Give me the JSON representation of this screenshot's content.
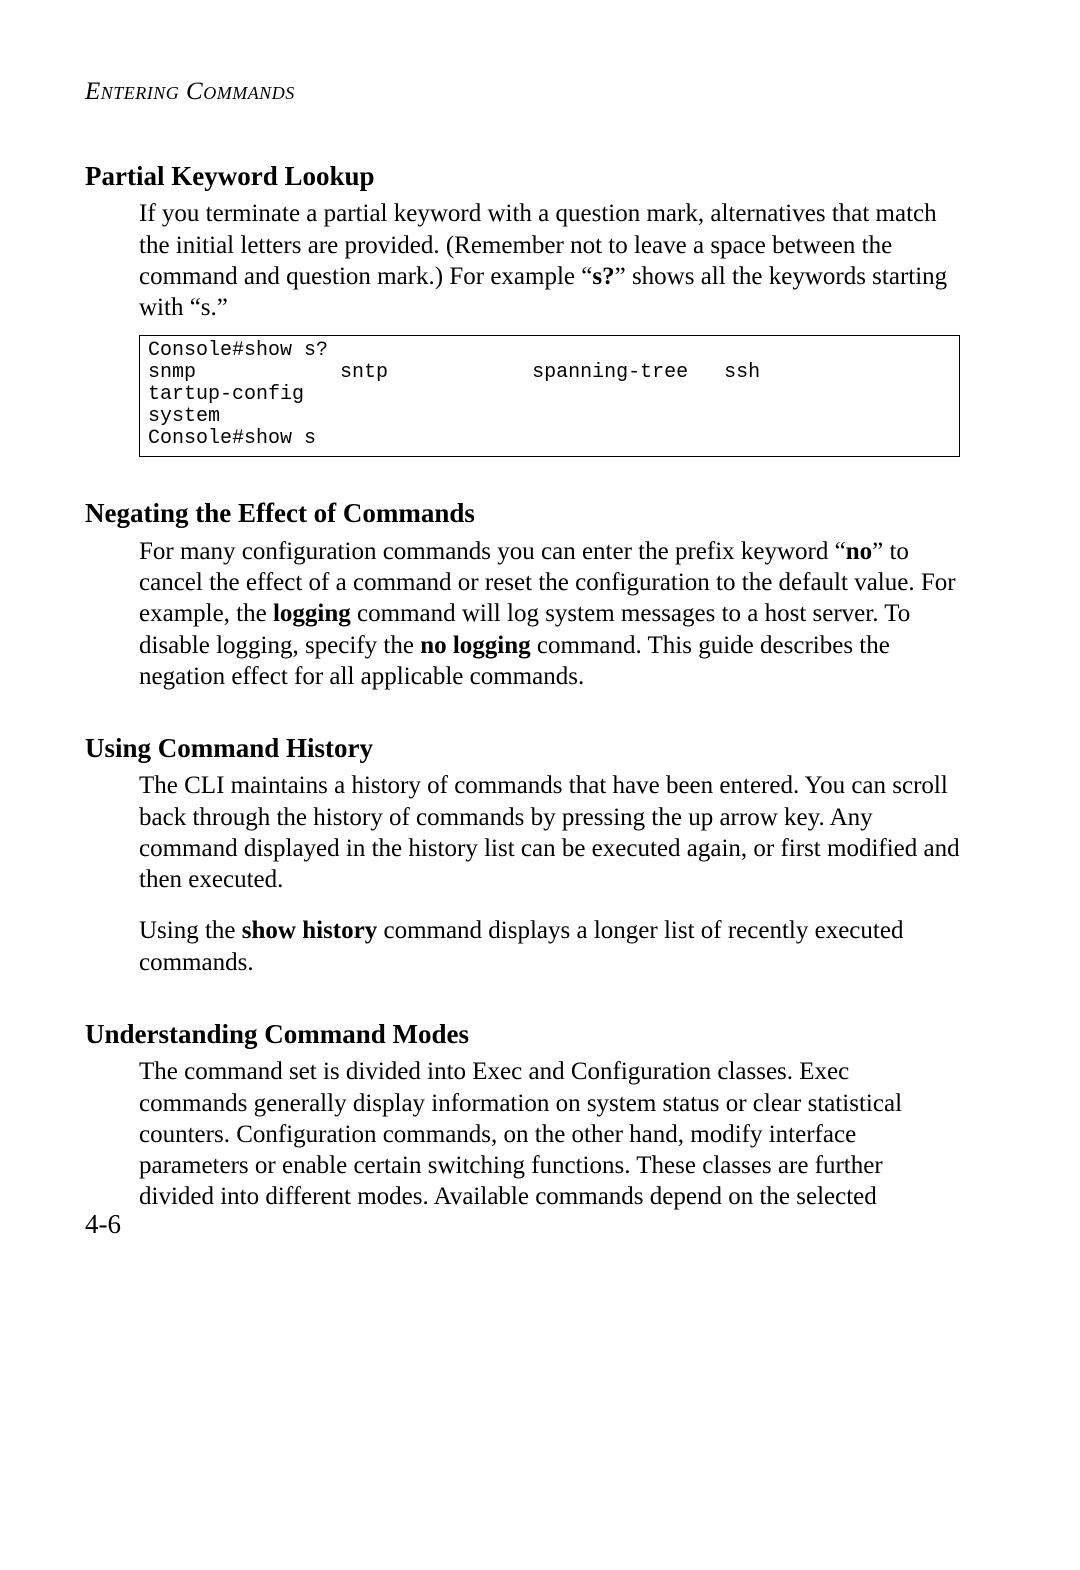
{
  "running_head": "Entering Commands",
  "sections": {
    "partial": {
      "title": "Partial Keyword Lookup",
      "para_html": "If you terminate a partial keyword with a question mark, alternatives that match the initial letters are provided. (Remember not to leave a space between the command and question mark.) For example “<b>s?</b>” shows all the keywords starting with “s.”",
      "code": "Console#show s?\nsnmp            sntp            spanning-tree   ssh\ntartup-config\nsystem\nConsole#show s"
    },
    "negating": {
      "title": "Negating the Effect of Commands",
      "para_html": "For many configuration commands you can enter the prefix keyword “<b>no</b>” to cancel the effect of a command or reset the configuration to the default value. For example, the <b>logging</b> command will log system messages to a host server. To disable logging, specify the <b>no logging</b> command. This guide describes the negation effect for all applicable commands."
    },
    "history": {
      "title": "Using Command History",
      "para1": "The CLI maintains a history of commands that have been entered. You can scroll back through the history of commands by pressing the up arrow key. Any command displayed in the history list can be executed again, or first modified and then executed.",
      "para2_html": "Using the <b>show history</b> command displays a longer list of recently executed commands."
    },
    "modes": {
      "title": "Understanding Command Modes",
      "para": "The command set is divided into Exec and Configuration classes. Exec commands generally display information on system status or clear statistical counters. Configuration commands, on the other hand, modify interface parameters or enable certain switching functions. These classes are further divided into different modes. Available commands depend on the selected"
    }
  },
  "page_number": "4-6"
}
